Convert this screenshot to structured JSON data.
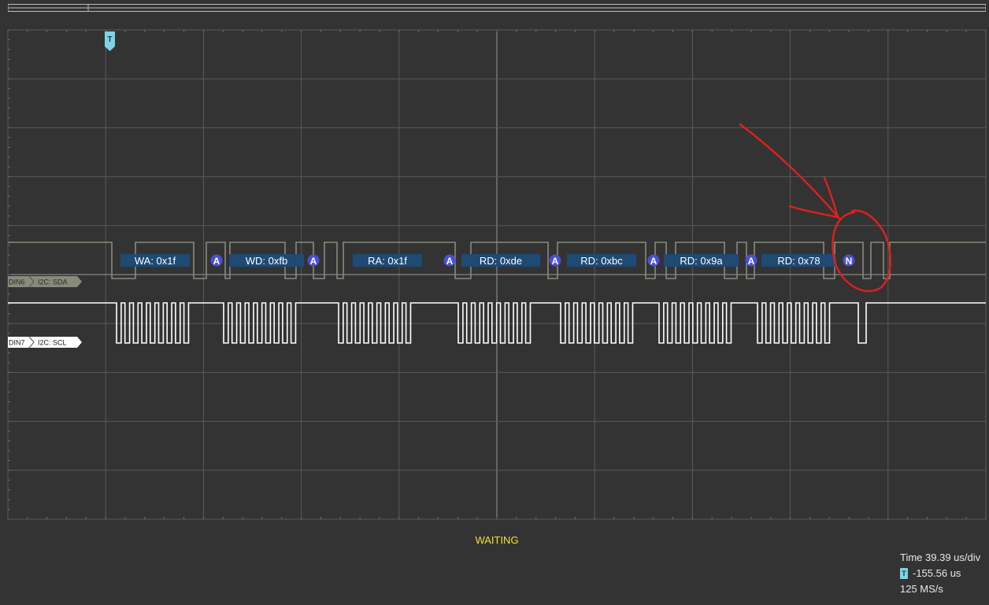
{
  "trigger": {
    "label": "T"
  },
  "channels": [
    {
      "id": "DIN6",
      "decoder": "I2C: SDA",
      "color": "#8a8a7a"
    },
    {
      "id": "DIN7",
      "decoder": "I2C: SCL",
      "color": "#ffffff"
    }
  ],
  "decode": {
    "frames": [
      {
        "text": "WA: 0x1f"
      },
      {
        "text": "A"
      },
      {
        "text": "WD: 0xfb"
      },
      {
        "text": "A"
      },
      {
        "text": "RA: 0x1f"
      },
      {
        "text": "A"
      },
      {
        "text": "RD: 0xde"
      },
      {
        "text": "A"
      },
      {
        "text": "RD: 0xbc"
      },
      {
        "text": "A"
      },
      {
        "text": "RD: 0x9a"
      },
      {
        "text": "A"
      },
      {
        "text": "RD: 0x78"
      },
      {
        "text": "N"
      }
    ],
    "frame_color": "#1e4a74",
    "ack_color": "#4a4fd6"
  },
  "status": {
    "text": "WAITING"
  },
  "readout": {
    "timebase": "Time 39.39 us/div",
    "trigger_offset": "-155.56 us",
    "sample_rate": "125 MS/s"
  },
  "colors": {
    "background": "#333333",
    "grid": "#5a5a5a",
    "annotation": "#e0201c",
    "status": "#f2e234",
    "trigger": "#7fd3e6"
  }
}
